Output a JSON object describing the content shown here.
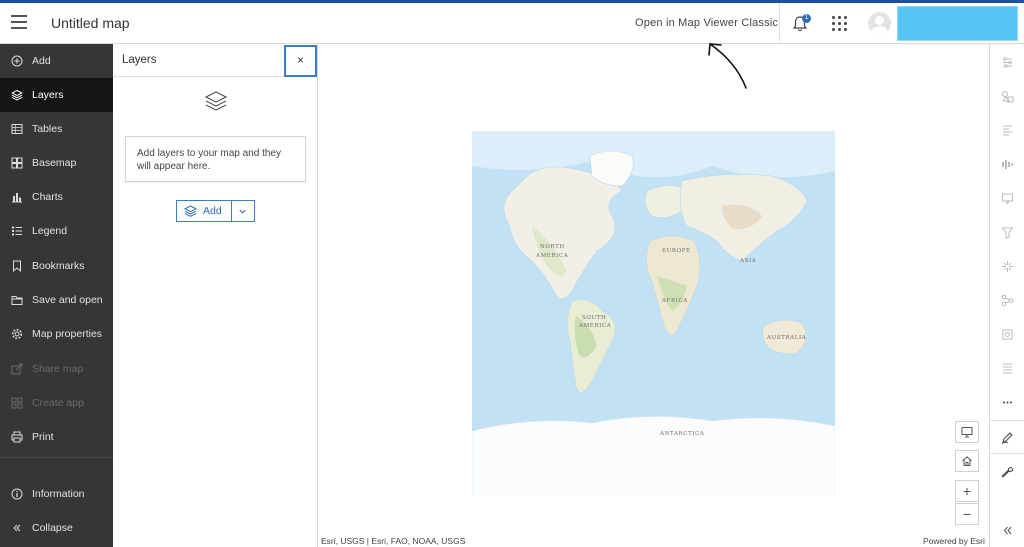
{
  "header": {
    "title": "Untitled map",
    "open_classic": "Open in Map Viewer Classic",
    "notification_count": "1",
    "brand_color": "#1f4f9e"
  },
  "sidebar": {
    "items": [
      {
        "label": "Add",
        "icon": "plus-circle-icon",
        "state": "normal"
      },
      {
        "label": "Layers",
        "icon": "layers-icon",
        "state": "active"
      },
      {
        "label": "Tables",
        "icon": "table-icon",
        "state": "normal"
      },
      {
        "label": "Basemap",
        "icon": "basemap-icon",
        "state": "normal"
      },
      {
        "label": "Charts",
        "icon": "chart-icon",
        "state": "normal"
      },
      {
        "label": "Legend",
        "icon": "legend-icon",
        "state": "normal"
      },
      {
        "label": "Bookmarks",
        "icon": "bookmark-icon",
        "state": "normal"
      },
      {
        "label": "Save and open",
        "icon": "folder-icon",
        "state": "normal"
      },
      {
        "label": "Map properties",
        "icon": "gear-icon",
        "state": "normal"
      },
      {
        "label": "Share map",
        "icon": "share-icon",
        "state": "disabled"
      },
      {
        "label": "Create app",
        "icon": "apps-icon",
        "state": "disabled"
      },
      {
        "label": "Print",
        "icon": "printer-icon",
        "state": "normal"
      }
    ],
    "information": "Information",
    "collapse": "Collapse"
  },
  "layers_panel": {
    "title": "Layers",
    "close": "×",
    "empty_message": "Add layers to your map and they will appear here.",
    "add_button": "Add"
  },
  "map": {
    "labels": [
      "NORTH",
      "AMERICA",
      "EUROPE",
      "ASIA",
      "AFRICA",
      "SOUTH",
      "AMERICA",
      "AUSTRALIA",
      "ANTARCTICA"
    ],
    "attribution": "Esri, USGS | Esri, FAO, NOAA, USGS",
    "powered_by": "Powered by Esri",
    "zoom_in": "+",
    "zoom_out": "−"
  }
}
